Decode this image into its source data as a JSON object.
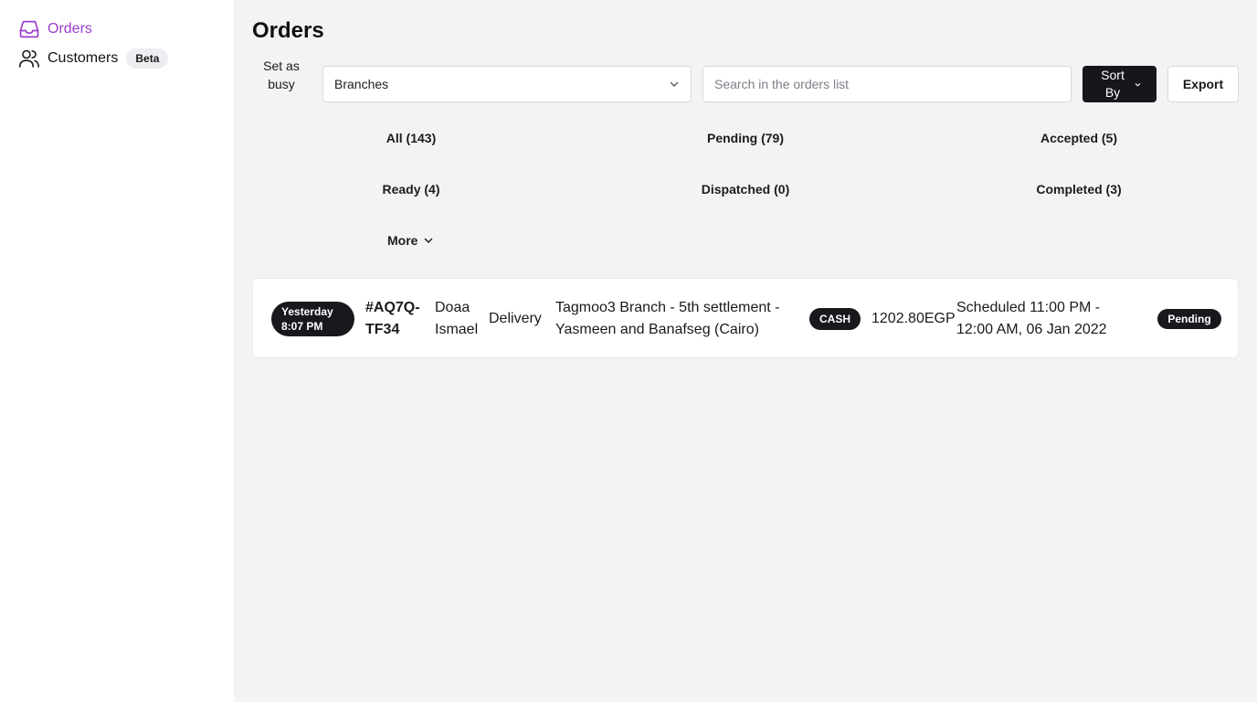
{
  "sidebar": {
    "items": [
      {
        "label": "Orders",
        "icon": "inbox-icon"
      },
      {
        "label": "Customers",
        "icon": "users-icon",
        "badge": "Beta"
      }
    ]
  },
  "header": {
    "title": "Orders",
    "busy_toggle_label": "Set as busy",
    "branches_select": {
      "value": "Branches",
      "icon": "chevron-down-icon"
    },
    "search": {
      "placeholder": "Search in the orders list",
      "value": ""
    },
    "sort_button": {
      "label": "Sort By",
      "icon": "chevron-down-icon"
    },
    "export_button": {
      "label": "Export"
    }
  },
  "tabs": [
    {
      "label": "All (143)"
    },
    {
      "label": "Pending (79)"
    },
    {
      "label": "Accepted (5)"
    },
    {
      "label": "Ready (4)"
    },
    {
      "label": "Dispatched (0)"
    },
    {
      "label": "Completed (3)"
    }
  ],
  "more_button": {
    "label": "More",
    "icon": "chevron-down-icon"
  },
  "orders": [
    {
      "time": "Yesterday 8:07 PM",
      "id": "#AQ7Q-TF34",
      "customer": "Doaa Ismael",
      "type": "Delivery",
      "branch": "Tagmoo3 Branch - 5th settlement - Yasmeen and Banafseg (Cairo)",
      "payment": "CASH",
      "amount": "1202.80EGP",
      "schedule": "Scheduled 11:00 PM - 12:00 AM, 06 Jan 2022",
      "status": "Pending"
    }
  ],
  "colors": {
    "accent": "#9c3fce",
    "dark": "#17191d",
    "background": "#f2f3f5",
    "surface": "#ffffff"
  }
}
